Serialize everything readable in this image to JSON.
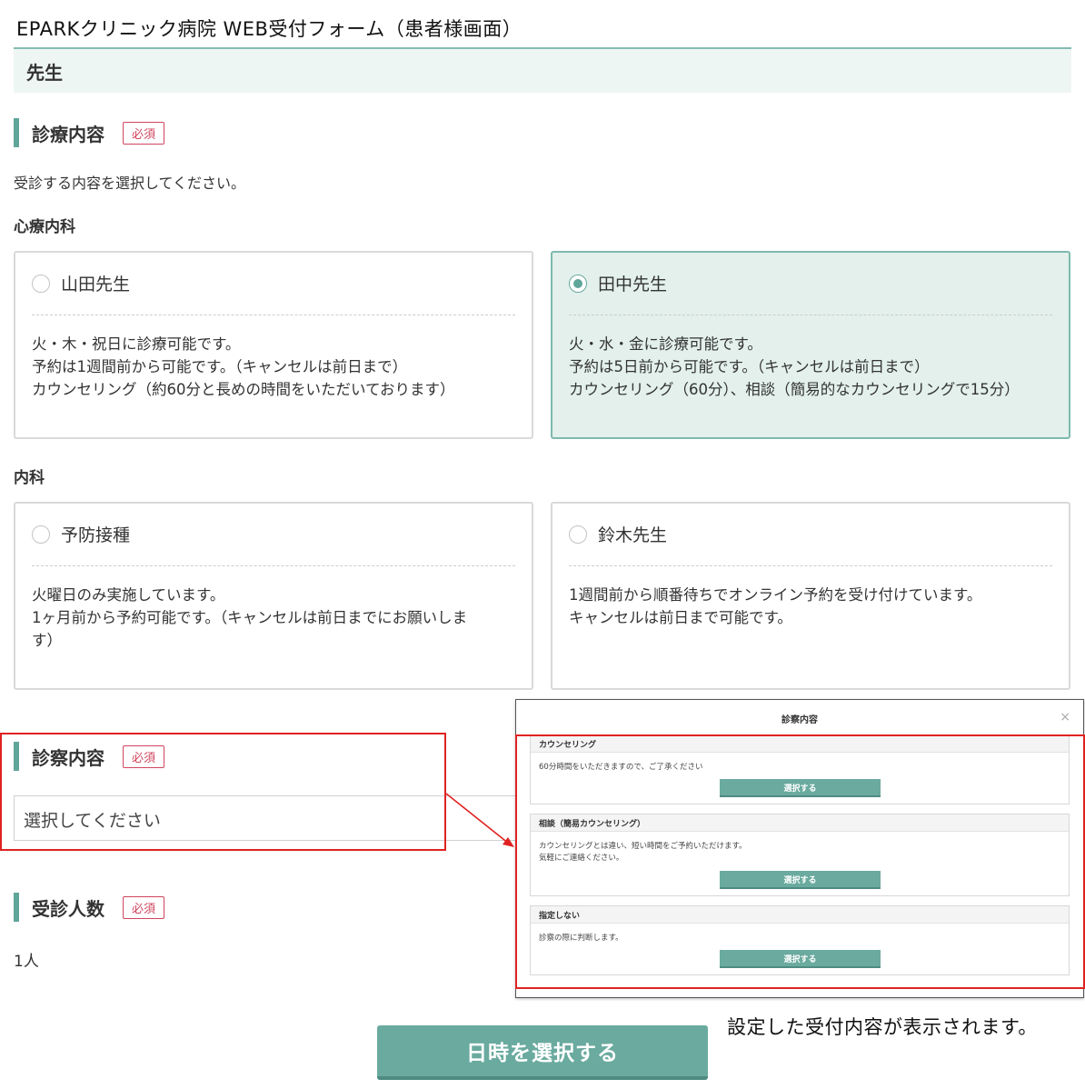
{
  "page_title": "EPARKクリニック病院 WEB受付フォーム（患者様画面）",
  "doctor_label": "先生",
  "consultation": {
    "title": "診療内容",
    "required": "必須",
    "instruction": "受診する内容を選択してください。",
    "groups": [
      {
        "category": "心療内科",
        "cards": [
          {
            "name": "山田先生",
            "selected": false,
            "lines": [
              "火・木・祝日に診療可能です。",
              "予約は1週間前から可能です。（キャンセルは前日まで）",
              "カウンセリング（約60分と長めの時間をいただいております）"
            ]
          },
          {
            "name": "田中先生",
            "selected": true,
            "lines": [
              "火・水・金に診療可能です。",
              "予約は5日前から可能です。（キャンセルは前日まで）",
              "カウンセリング（60分）、相談（簡易的なカウンセリングで15分）"
            ]
          }
        ]
      },
      {
        "category": "内科",
        "cards": [
          {
            "name": "予防接種",
            "selected": false,
            "lines": [
              "火曜日のみ実施しています。",
              "1ヶ月前から予約可能です。（キャンセルは前日までにお願いしま",
              "す）"
            ]
          },
          {
            "name": "鈴木先生",
            "selected": false,
            "lines": [
              "1週間前から順番待ちでオンライン予約を受け付けています。",
              "キャンセルは前日まで可能です。"
            ]
          }
        ]
      }
    ]
  },
  "exam": {
    "title": "診察内容",
    "required": "必須",
    "placeholder": "選択してください"
  },
  "patients": {
    "title": "受診人数",
    "required": "必須",
    "value": "1人"
  },
  "submit_label": "日時を選択する",
  "callout": "設定した受付内容が表示されます。",
  "modal": {
    "title": "診察内容",
    "close": "×",
    "options": [
      {
        "head": "カウンセリング",
        "desc": [
          "60分時間をいただきますので、ご了承ください"
        ],
        "button": "選択する"
      },
      {
        "head": "相談（簡易カウンセリング）",
        "desc": [
          "カウンセリングとは違い、短い時間をご予約いただけます。",
          "気軽にご連絡ください。"
        ],
        "button": "選択する"
      },
      {
        "head": "指定しない",
        "desc": [
          "診察の際に判断します。"
        ],
        "button": "選択する"
      }
    ]
  },
  "colors": {
    "accent": "#5fa69a",
    "required": "#d0455e",
    "highlight": "#e02222",
    "selected_bg": "#e3f0ec"
  }
}
